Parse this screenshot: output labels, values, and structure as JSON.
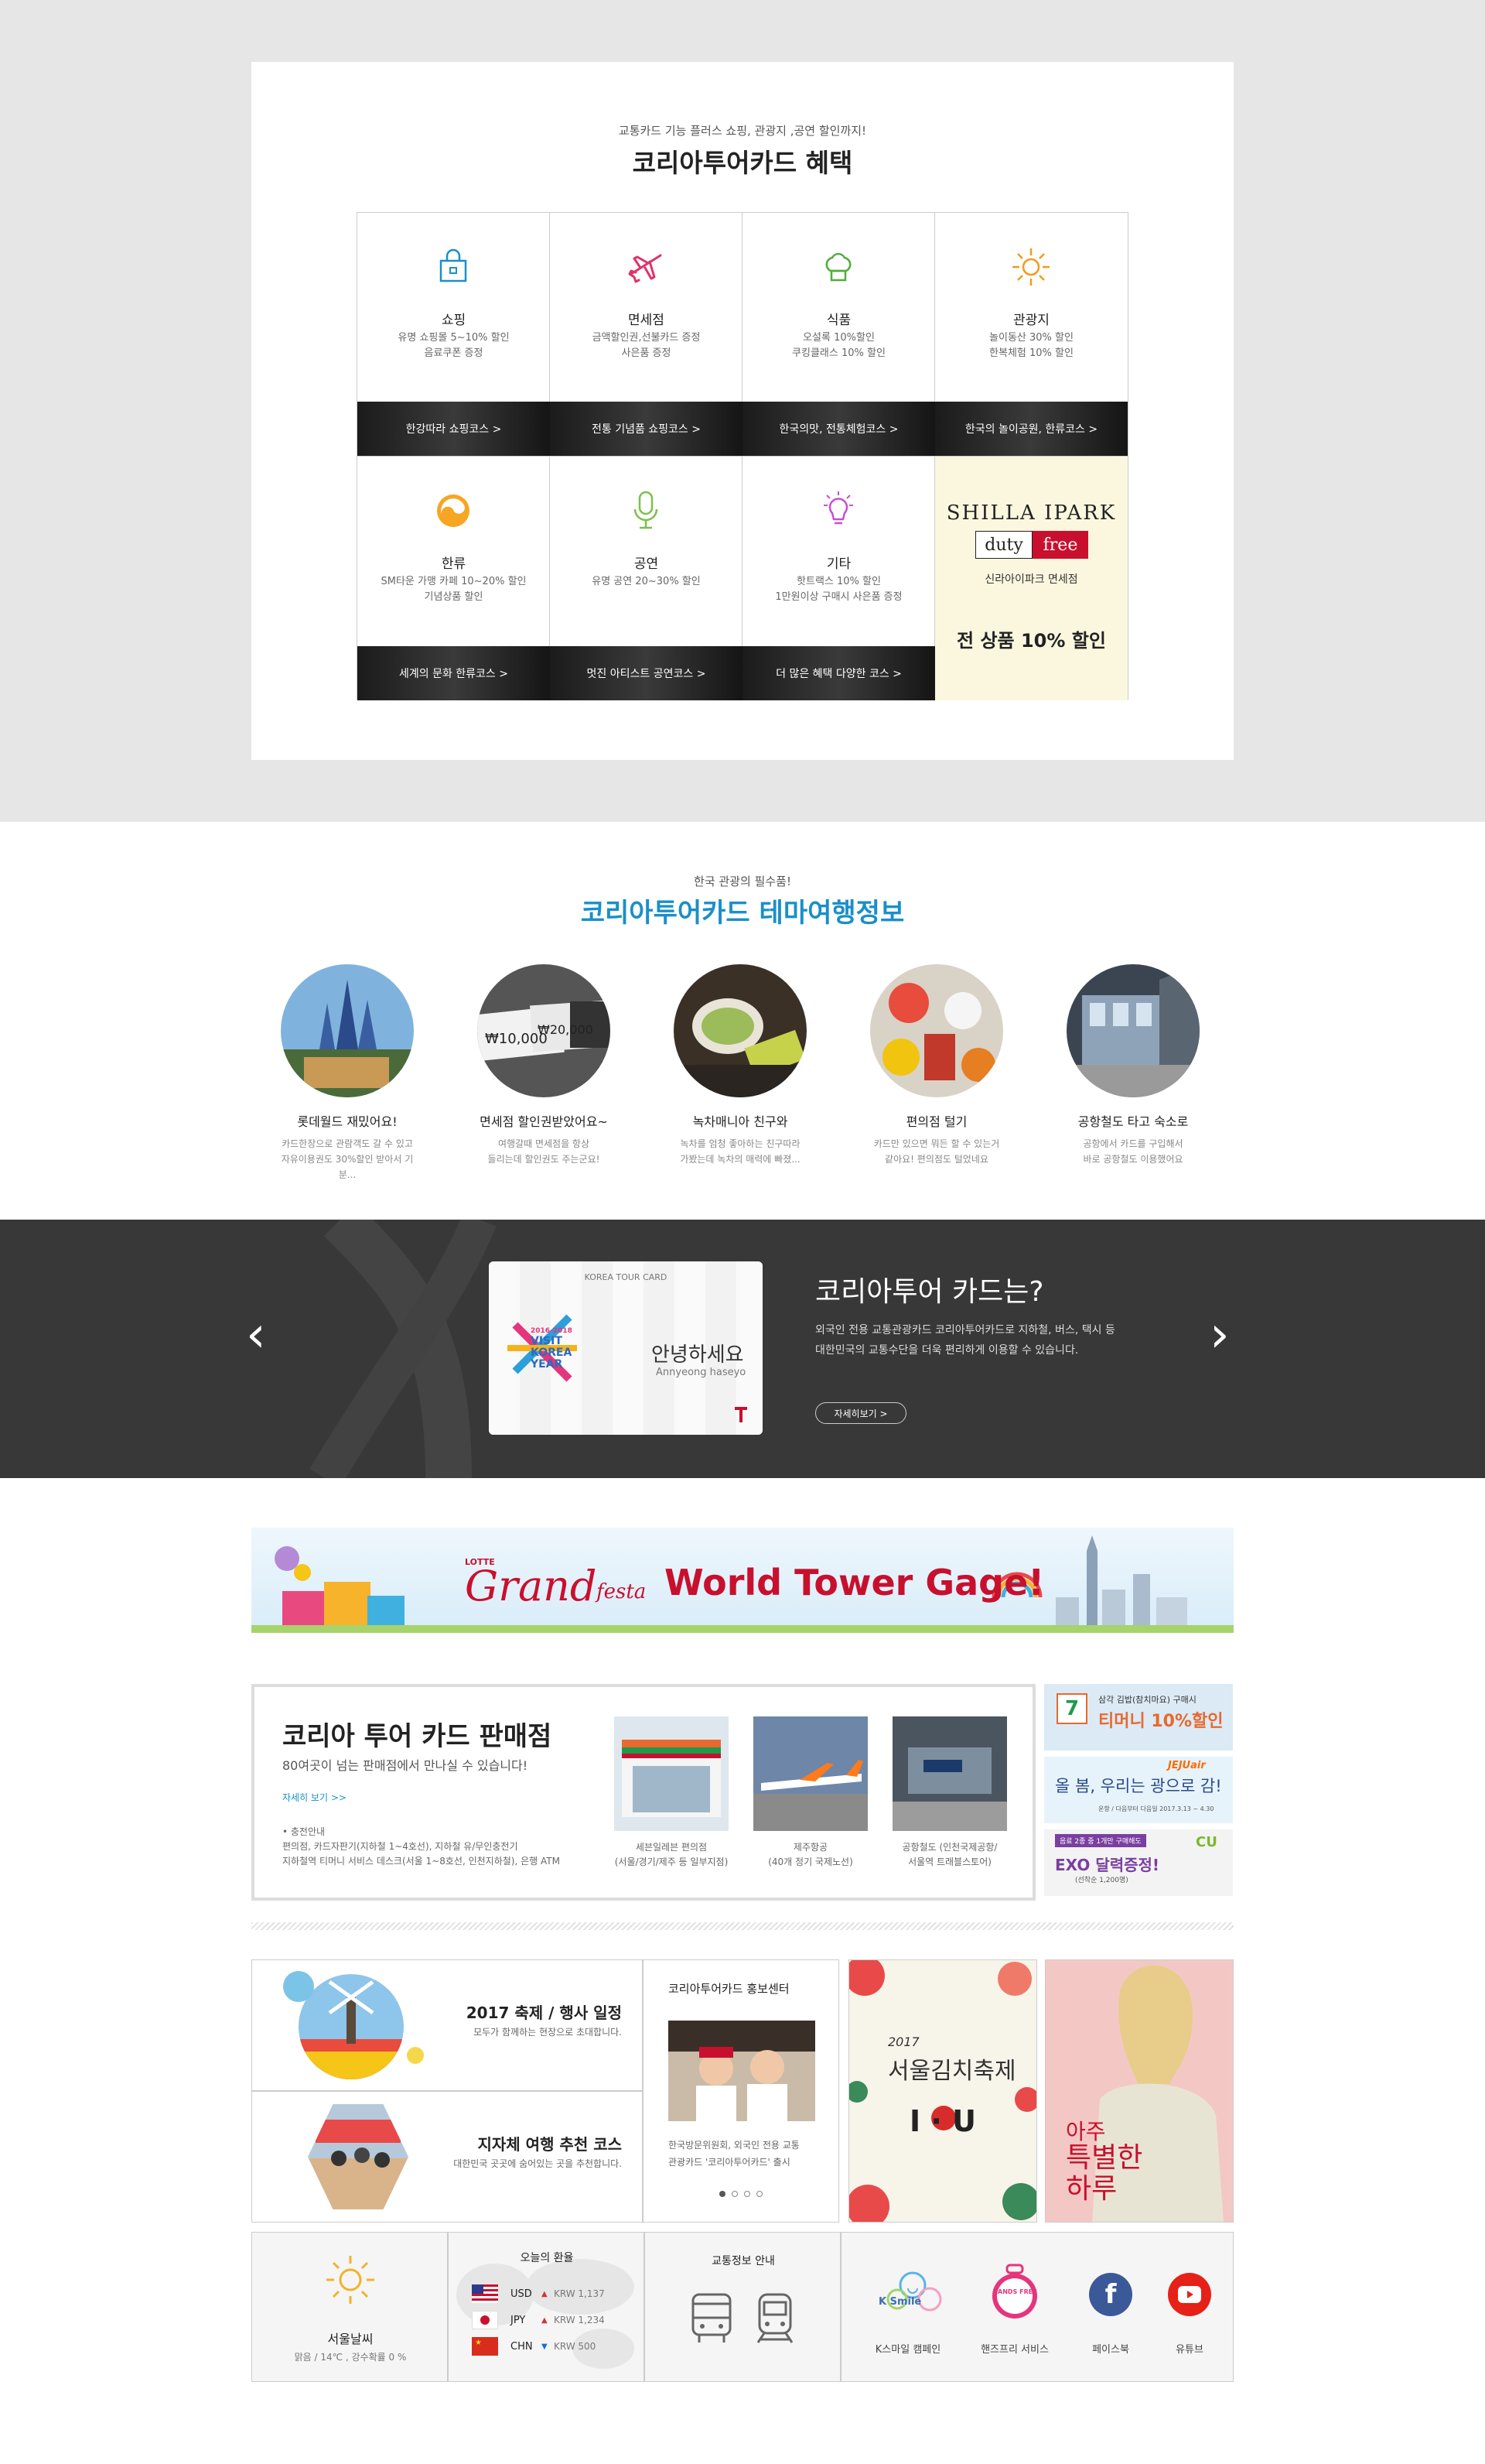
{
  "benefits": {
    "subtitle": "교통카드 기능 플러스 쇼핑, 관광지 ,공연 할인까지!",
    "title": "코리아투어카드 혜택",
    "items": [
      {
        "name": "쇼핑",
        "desc1": "유명 쇼핑몰 5~10% 할인",
        "desc2": "음료쿠폰 증정",
        "course": "한강따라 쇼핑코스 >",
        "icon": "shopping-bag-icon"
      },
      {
        "name": "면세점",
        "desc1": "금액할인권,선불카드 증정",
        "desc2": "사은품 증정",
        "course": "전통 기념품 쇼핑코스 >",
        "icon": "airplane-icon"
      },
      {
        "name": "식품",
        "desc1": "오설록 10%할인",
        "desc2": "쿠킹클래스 10% 할인",
        "course": "한국의맛, 전통체험코스 >",
        "icon": "chef-hat-icon"
      },
      {
        "name": "관광지",
        "desc1": "놀이동산 30% 할인",
        "desc2": "한복체험 10% 할인",
        "course": "한국의 놀이공원, 한류코스 >",
        "icon": "sun-icon"
      },
      {
        "name": "한류",
        "desc1": "SM타운 가맹 카페 10~20% 할인",
        "desc2": "기념상품 할인",
        "course": "세계의 문화 한류코스 >",
        "icon": "taegeuk-icon"
      },
      {
        "name": "공연",
        "desc1": "유명 공연 20~30% 할인",
        "desc2": "",
        "course": "멋진 아티스트 공연코스 >",
        "icon": "microphone-icon"
      },
      {
        "name": "기타",
        "desc1": "핫트랙스 10% 할인",
        "desc2": "1만원이상 구매시 사은품 증정",
        "course": "더 많은 혜택 다양한 코스 >",
        "icon": "lightbulb-icon"
      }
    ],
    "shilla": {
      "logo": "SHILLA IPARK",
      "duty": "duty",
      "free": "free",
      "name": "신라아이파크 면세점",
      "offer": "전 상품 10% 할인"
    }
  },
  "themes": {
    "subtitle": "한국 관광의 필수품!",
    "title": "코리아투어카드 테마여행정보",
    "items": [
      {
        "name": "롯데월드 재밌어요!",
        "d1": "카드한장으로 관람객도 갈 수 있고",
        "d2": "자유이용권도 30%할인 받아서 기분..."
      },
      {
        "name": "면세점 할인권받았어요~",
        "d1": "여행갈때 면세점을 항상",
        "d2": "들리는데 할인권도 주는군요!"
      },
      {
        "name": "녹차매니아 친구와",
        "d1": "녹차를 엄청 좋아하는 친구따라",
        "d2": "가봤는데 녹차의 매력에 빠졌..."
      },
      {
        "name": "편의점 털기",
        "d1": "카드만 있으면 뭐든 할 수 있는거",
        "d2": "같아요! 편의점도 털었네요"
      },
      {
        "name": "공항철도 타고 숙소로",
        "d1": "공항에서 카드를 구입해서",
        "d2": "바로 공항철도 이용했어요"
      }
    ]
  },
  "about": {
    "title": "코리아투어 카드는?",
    "desc1": "외국인 전용 교통관광카드 코리아투어카드로 지하철, 버스, 택시 등",
    "desc2": "대한민국의 교통수단을 더욱 편리하게 이용할 수 있습니다.",
    "more": "자세히보기  >",
    "card_header": "KOREA TOUR CARD",
    "card_hello": "안녕하세요",
    "card_roman": "Annyeong haseyo",
    "card_logo1": "2016-2018",
    "card_logo2": "VISIT",
    "card_logo3": "KOREA",
    "card_logo4": "YEAR"
  },
  "banner": {
    "lotte": "LOTTE",
    "grand": "Grand",
    "festa": "festa",
    "text": "World Tower Gage!"
  },
  "stores": {
    "title": "코리아 투어 카드 판매점",
    "sub": "80여곳이 넘는 판매점에서 만나실 수 있습니다!",
    "more": "자세히 보기 >>",
    "info1": "• 충전안내",
    "info2": "편의점, 카드자판기(지하철 1~4호선), 지하철 유/무인충전기",
    "info3": "지하철역 티머니 서비스 데스크(서울 1~8호선, 인천지하철), 은행 ATM",
    "places": [
      {
        "c1": "세븐일레븐 편의점",
        "c2": "(서울/경기/제주 등 일부지점)"
      },
      {
        "c1": "제주항공",
        "c2": "(40개 정기 국제노선)"
      },
      {
        "c1": "공항철도 (인천국제공항/",
        "c2": "서울역 트래블스토어)"
      }
    ],
    "ads": [
      {
        "l1": "삼각 김밥(참치마요) 구매시",
        "l2": "티머니 10%할인"
      },
      {
        "l1": "올 봄, 우리는 광으로 감!",
        "l2": "JEJUair",
        "l3": "운항 / 다음부터 다음일 2017.3.13 ~ 4.30"
      },
      {
        "l1": "음료 2종 중 1개만 구매해도",
        "l2": "EXO 달력증정!",
        "l3": "(선착순 1,200명)",
        "l4": "CU"
      }
    ]
  },
  "news": {
    "fest_title": "2017 축제 / 행사 일정",
    "fest_desc": "모두가 함께하는 현장으로 초대합니다.",
    "local_title": "지자체 여행 추천 코스",
    "local_desc": "대한민국 곳곳에 숨어있는 곳을 추천합니다.",
    "promo_title": "코리아투어카드 홍보센터",
    "promo_d1": "한국방문위원회, 외국인 전용 교통",
    "promo_d2": "관광카드 '코리아투어카드' 출시",
    "poster1_year": "2017",
    "poster1_title": "서울김치축제",
    "poster1_iou": "I · U",
    "poster2_t1": "아주",
    "poster2_t2": "특별한 하루"
  },
  "footer": {
    "weather_city": "서울날씨",
    "weather_desc": "맑음 / 14℃ , 강수확률 0 %",
    "rate_title": "오늘의 환율",
    "rates": [
      {
        "cur": "USD",
        "dir": "▲",
        "val": "KRW 1,137",
        "color": "#d0343a"
      },
      {
        "cur": "JPY",
        "dir": "▲",
        "val": "KRW 1,234",
        "color": "#d0343a"
      },
      {
        "cur": "CHN",
        "dir": "▼",
        "val": "KRW 500",
        "color": "#1a6fd0"
      }
    ],
    "transport_title": "교통정보 안내",
    "links": [
      {
        "label": "K스마일 캠페인",
        "icon": "ksmile-icon"
      },
      {
        "label": "핸즈프리 서비스",
        "icon": "hands-free-icon"
      },
      {
        "label": "페이스북",
        "icon": "facebook-icon"
      },
      {
        "label": "유튜브",
        "icon": "youtube-icon"
      }
    ],
    "ksmile": "K Smile",
    "handsfree": "HANDS FREE"
  }
}
